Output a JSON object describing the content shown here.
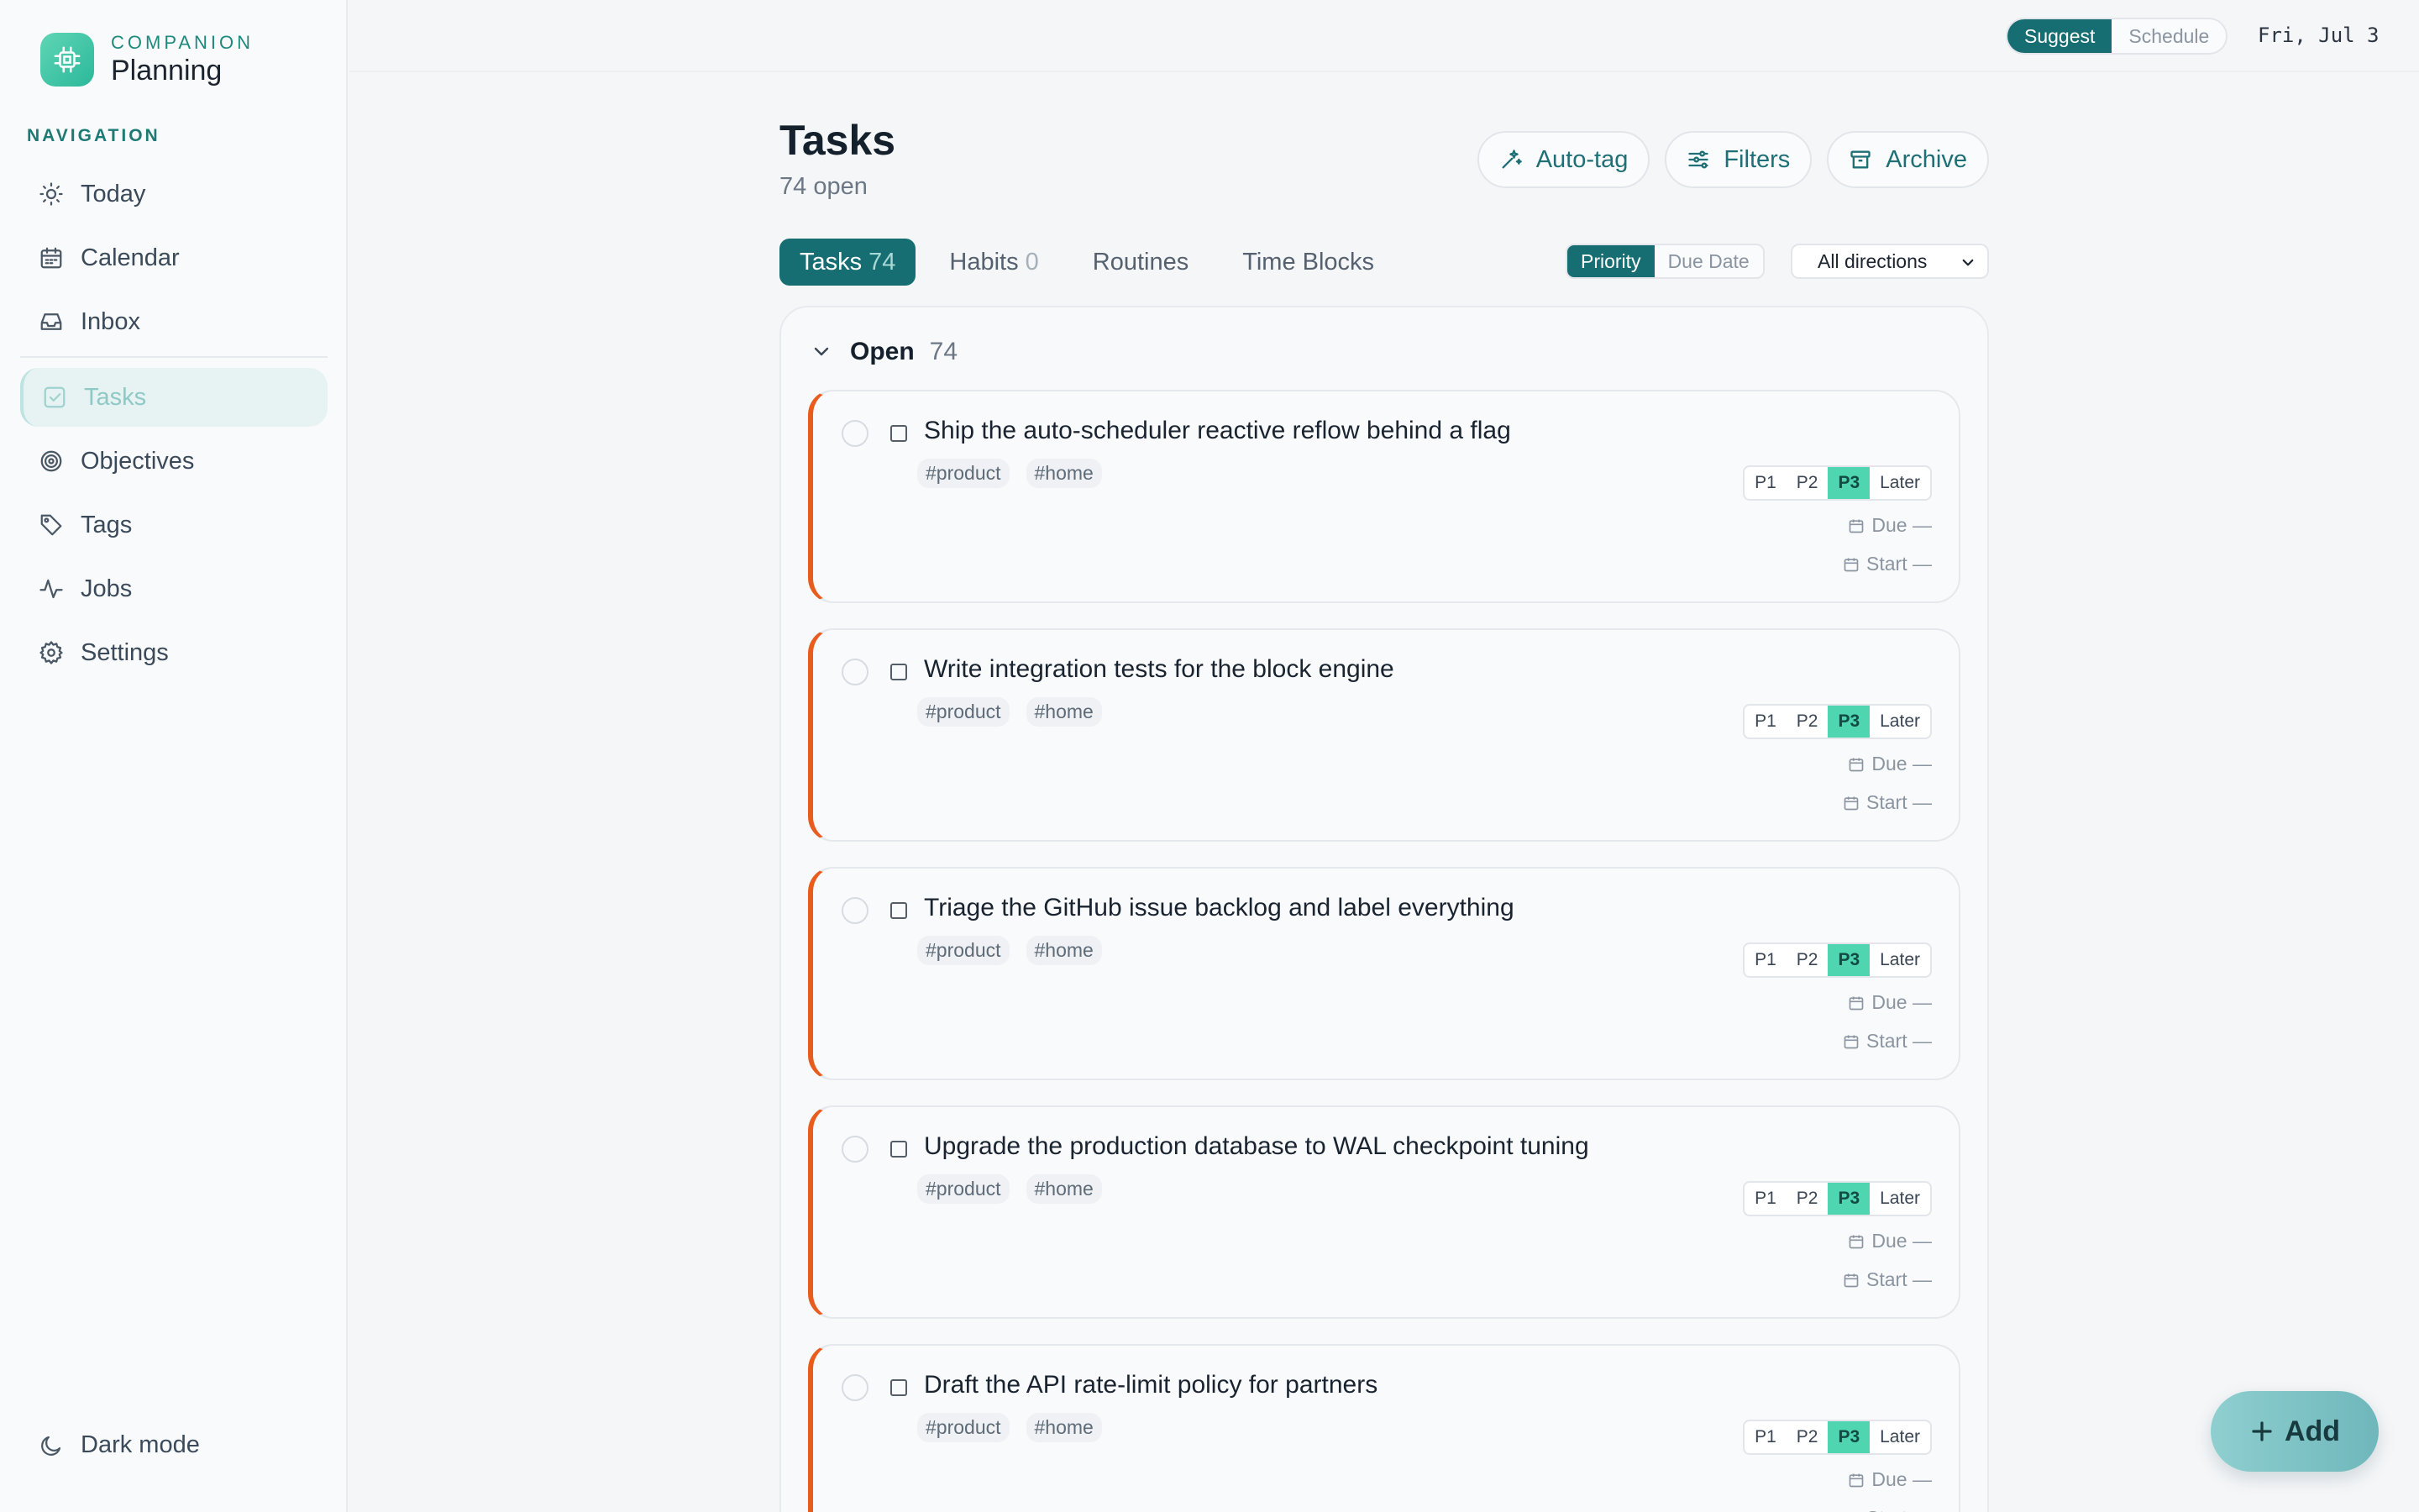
{
  "brand": {
    "subtitle": "COMPANION",
    "title": "Planning"
  },
  "nav": {
    "heading": "NAVIGATION",
    "items": [
      {
        "label": "Today",
        "icon": "sun-icon"
      },
      {
        "label": "Calendar",
        "icon": "calendar-icon"
      },
      {
        "label": "Inbox",
        "icon": "inbox-icon"
      },
      {
        "label": "Tasks",
        "icon": "checkbox-icon",
        "active": true
      },
      {
        "label": "Objectives",
        "icon": "target-icon"
      },
      {
        "label": "Tags",
        "icon": "tag-icon"
      },
      {
        "label": "Jobs",
        "icon": "activity-icon"
      },
      {
        "label": "Settings",
        "icon": "gear-icon"
      }
    ],
    "dark_mode_label": "Dark mode"
  },
  "topbar": {
    "mode": {
      "suggest": "Suggest",
      "schedule": "Schedule",
      "selected": "Suggest"
    },
    "date": "Fri, Jul 3"
  },
  "page": {
    "title": "Tasks",
    "subtitle": "74 open",
    "actions": {
      "autotag": "Auto-tag",
      "filters": "Filters",
      "archive": "Archive"
    }
  },
  "tabs": [
    {
      "label": "Tasks",
      "count": "74",
      "active": true
    },
    {
      "label": "Habits",
      "count": "0"
    },
    {
      "label": "Routines",
      "count": ""
    },
    {
      "label": "Time Blocks",
      "count": ""
    }
  ],
  "sort": {
    "priority": "Priority",
    "due": "Due Date",
    "selected": "Priority"
  },
  "direction": {
    "selected": "All directions"
  },
  "group": {
    "title": "Open",
    "count": "74"
  },
  "priority_labels": [
    "P1",
    "P2",
    "P3",
    "Later"
  ],
  "meta_labels": {
    "due": "Due —",
    "start": "Start —"
  },
  "tasks": [
    {
      "title": "Ship the auto-scheduler reactive reflow behind a flag",
      "tags": [
        "#product",
        "#home"
      ],
      "priority": "P3"
    },
    {
      "title": "Write integration tests for the block engine",
      "tags": [
        "#product",
        "#home"
      ],
      "priority": "P3"
    },
    {
      "title": "Triage the GitHub issue backlog and label everything",
      "tags": [
        "#product",
        "#home"
      ],
      "priority": "P3"
    },
    {
      "title": "Upgrade the production database to WAL checkpoint tuning",
      "tags": [
        "#product",
        "#home"
      ],
      "priority": "P3"
    },
    {
      "title": "Draft the API rate-limit policy for partners",
      "tags": [
        "#product",
        "#home"
      ],
      "priority": "P3"
    }
  ],
  "fab": {
    "label": "Add"
  },
  "colors": {
    "accent": "#166e72",
    "priority_active": "#4fd6b0",
    "task_edge": "#e85d1e"
  }
}
